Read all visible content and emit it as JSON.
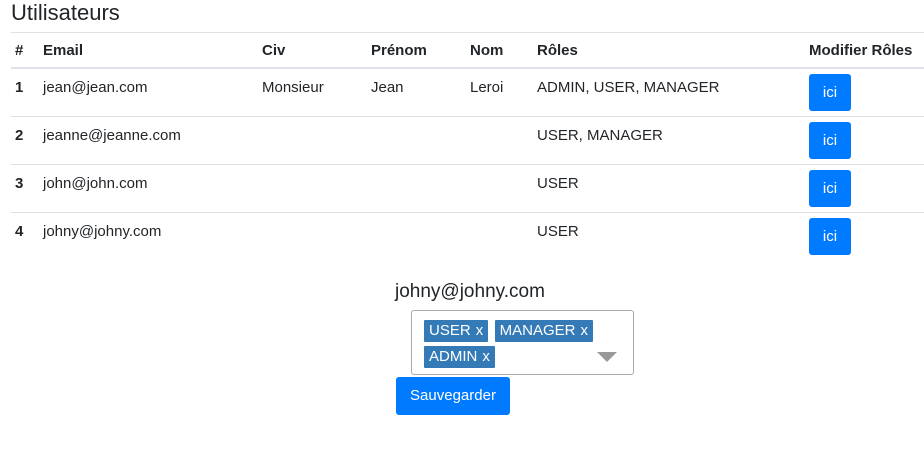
{
  "page": {
    "title": "Utilisateurs"
  },
  "table": {
    "headers": [
      "#",
      "Email",
      "Civ",
      "Prénom",
      "Nom",
      "Rôles",
      "Modifier Rôles"
    ],
    "rows": [
      {
        "index": "1",
        "email": "jean@jean.com",
        "civ": "Monsieur",
        "prenom": "Jean",
        "nom": "Leroi",
        "roles": "ADMIN, USER, MANAGER",
        "button": "ici"
      },
      {
        "index": "2",
        "email": "jeanne@jeanne.com",
        "civ": "",
        "prenom": "",
        "nom": "",
        "roles": "USER, MANAGER",
        "button": "ici"
      },
      {
        "index": "3",
        "email": "john@john.com",
        "civ": "",
        "prenom": "",
        "nom": "",
        "roles": "USER",
        "button": "ici"
      },
      {
        "index": "4",
        "email": "johny@johny.com",
        "civ": "",
        "prenom": "",
        "nom": "",
        "roles": "USER",
        "button": "ici"
      }
    ]
  },
  "editor": {
    "email": "johny@johny.com",
    "selected_roles": [
      "USER",
      "MANAGER",
      "ADMIN"
    ],
    "remove_symbol": "x",
    "save_label": "Sauvegarder"
  },
  "colors": {
    "primary": "#007bff",
    "tag": "#337ab7"
  }
}
